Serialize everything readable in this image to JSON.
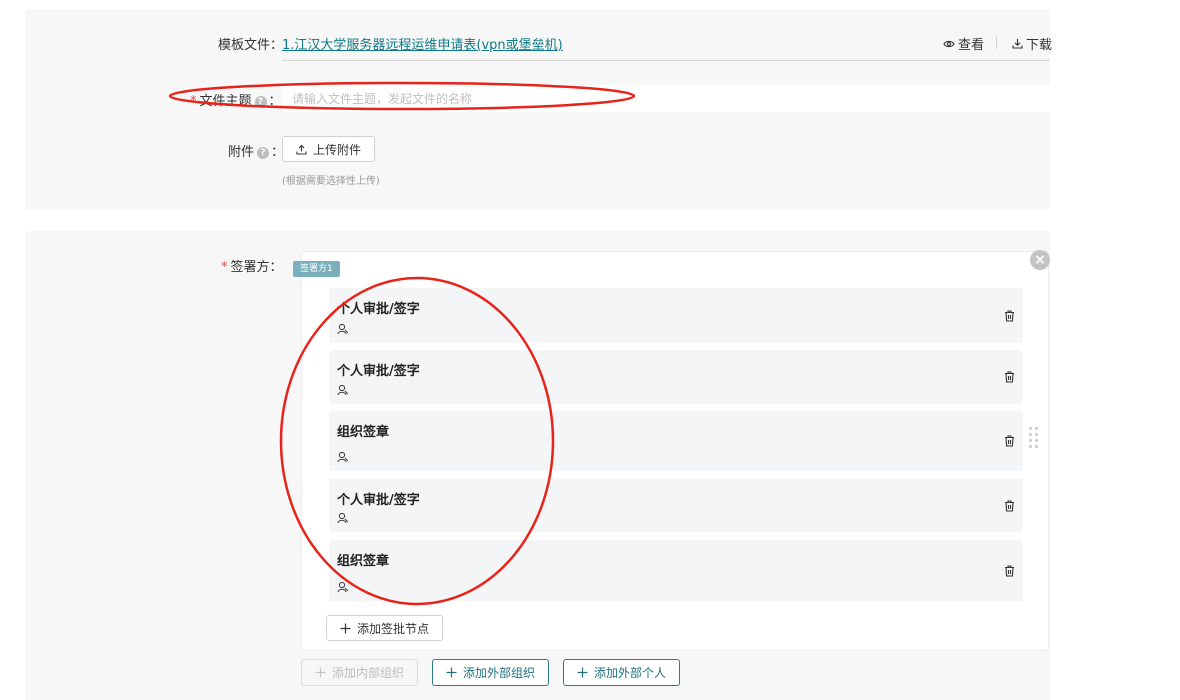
{
  "template": {
    "label": "模板文件",
    "link_text": "1.江汉大学服务器远程运维申请表(vpn或堡垒机)",
    "view_label": "查看",
    "download_label": "下载"
  },
  "subject": {
    "label": "文件主题",
    "placeholder": "请输入文件主题，发起文件的名称"
  },
  "attachment": {
    "label": "附件",
    "upload_label": "上传附件",
    "hint": "(根据需要选择性上传)"
  },
  "signers": {
    "label": "签署方",
    "tag": "签署方1",
    "nodes": [
      {
        "title": "个人审批/签字"
      },
      {
        "title": "个人审批/签字"
      },
      {
        "title": "组织签章"
      },
      {
        "title": "个人审批/签字"
      },
      {
        "title": "组织签章"
      }
    ],
    "add_node_label": "添加签批节点"
  },
  "footer_buttons": {
    "internal_org": "添加内部组织",
    "external_org": "添加外部组织",
    "external_person": "添加外部个人"
  },
  "colors": {
    "accent": "#1f6f7a",
    "link": "#0d7a86",
    "required": "#e54848",
    "annotation": "#e8231a",
    "tag_bg": "#7ab0bd"
  },
  "icons": [
    "eye-icon",
    "download-icon",
    "help-icon",
    "upload-icon",
    "close-icon",
    "person-icon",
    "trash-icon",
    "plus-icon",
    "drag-handle-icon"
  ]
}
